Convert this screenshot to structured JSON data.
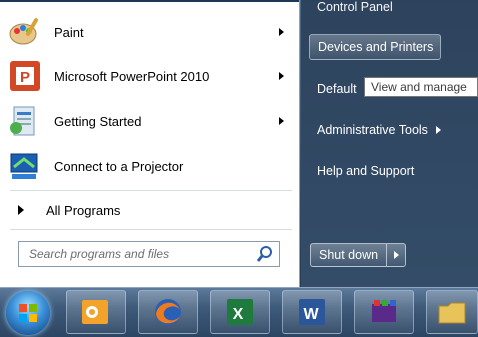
{
  "start_menu": {
    "pinned": [
      {
        "label": "Paint",
        "icon": "paint-icon",
        "has_arrow": true
      },
      {
        "label": "Microsoft PowerPoint 2010",
        "icon": "powerpoint-icon",
        "has_arrow": true
      },
      {
        "label": "Getting Started",
        "icon": "getting-started-icon",
        "has_arrow": true
      },
      {
        "label": "Connect to a Projector",
        "icon": "projector-icon",
        "has_arrow": false
      }
    ],
    "all_programs": "All Programs",
    "search_placeholder": "Search programs and files"
  },
  "right_pane": {
    "top_item": "Control Panel",
    "items": [
      {
        "label": "Devices and Printers"
      },
      {
        "label": "Default"
      },
      {
        "label": "Administrative Tools"
      },
      {
        "label": "Help and Support"
      }
    ],
    "tooltip": "View and manage",
    "shutdown": "Shut down"
  },
  "taskbar": {
    "apps": [
      "outlook-icon",
      "firefox-icon",
      "excel-icon",
      "word-icon",
      "media-icon",
      "explorer-icon"
    ]
  },
  "colors": {
    "accent": "#3a8fd8",
    "taskbar": "#3e5a7a"
  }
}
